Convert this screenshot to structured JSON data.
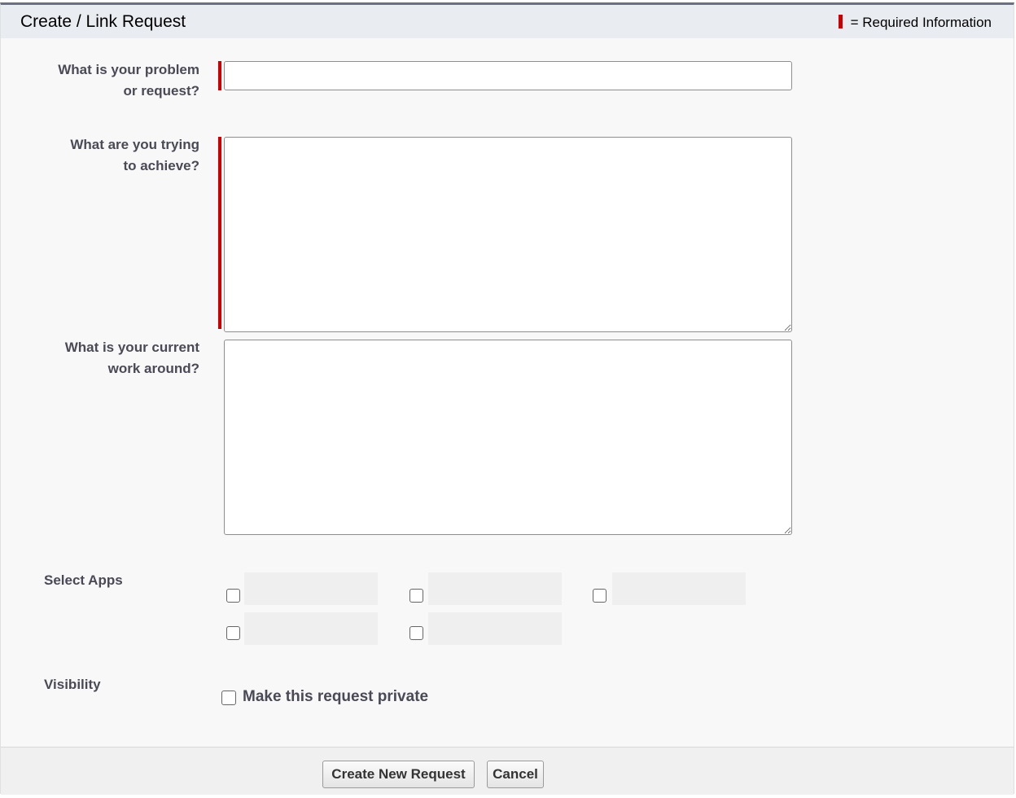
{
  "header": {
    "title": "Create / Link Request",
    "required_legend": "= Required Information"
  },
  "form": {
    "problem": {
      "label_line1": "What is your problem",
      "label_line2": "or request?",
      "value": ""
    },
    "goal": {
      "label_line1": "What are you trying",
      "label_line2": "to achieve?",
      "value": ""
    },
    "workaround": {
      "label_line1": "What is your current",
      "label_line2": "work around?",
      "value": ""
    },
    "apps": {
      "label": "Select Apps"
    },
    "visibility": {
      "label": "Visibility",
      "private_label": "Make this request private"
    }
  },
  "footer": {
    "create_label": "Create New Request",
    "cancel_label": "Cancel"
  },
  "colors": {
    "required": "#cc0000",
    "header_bg": "#e9ecf1"
  }
}
